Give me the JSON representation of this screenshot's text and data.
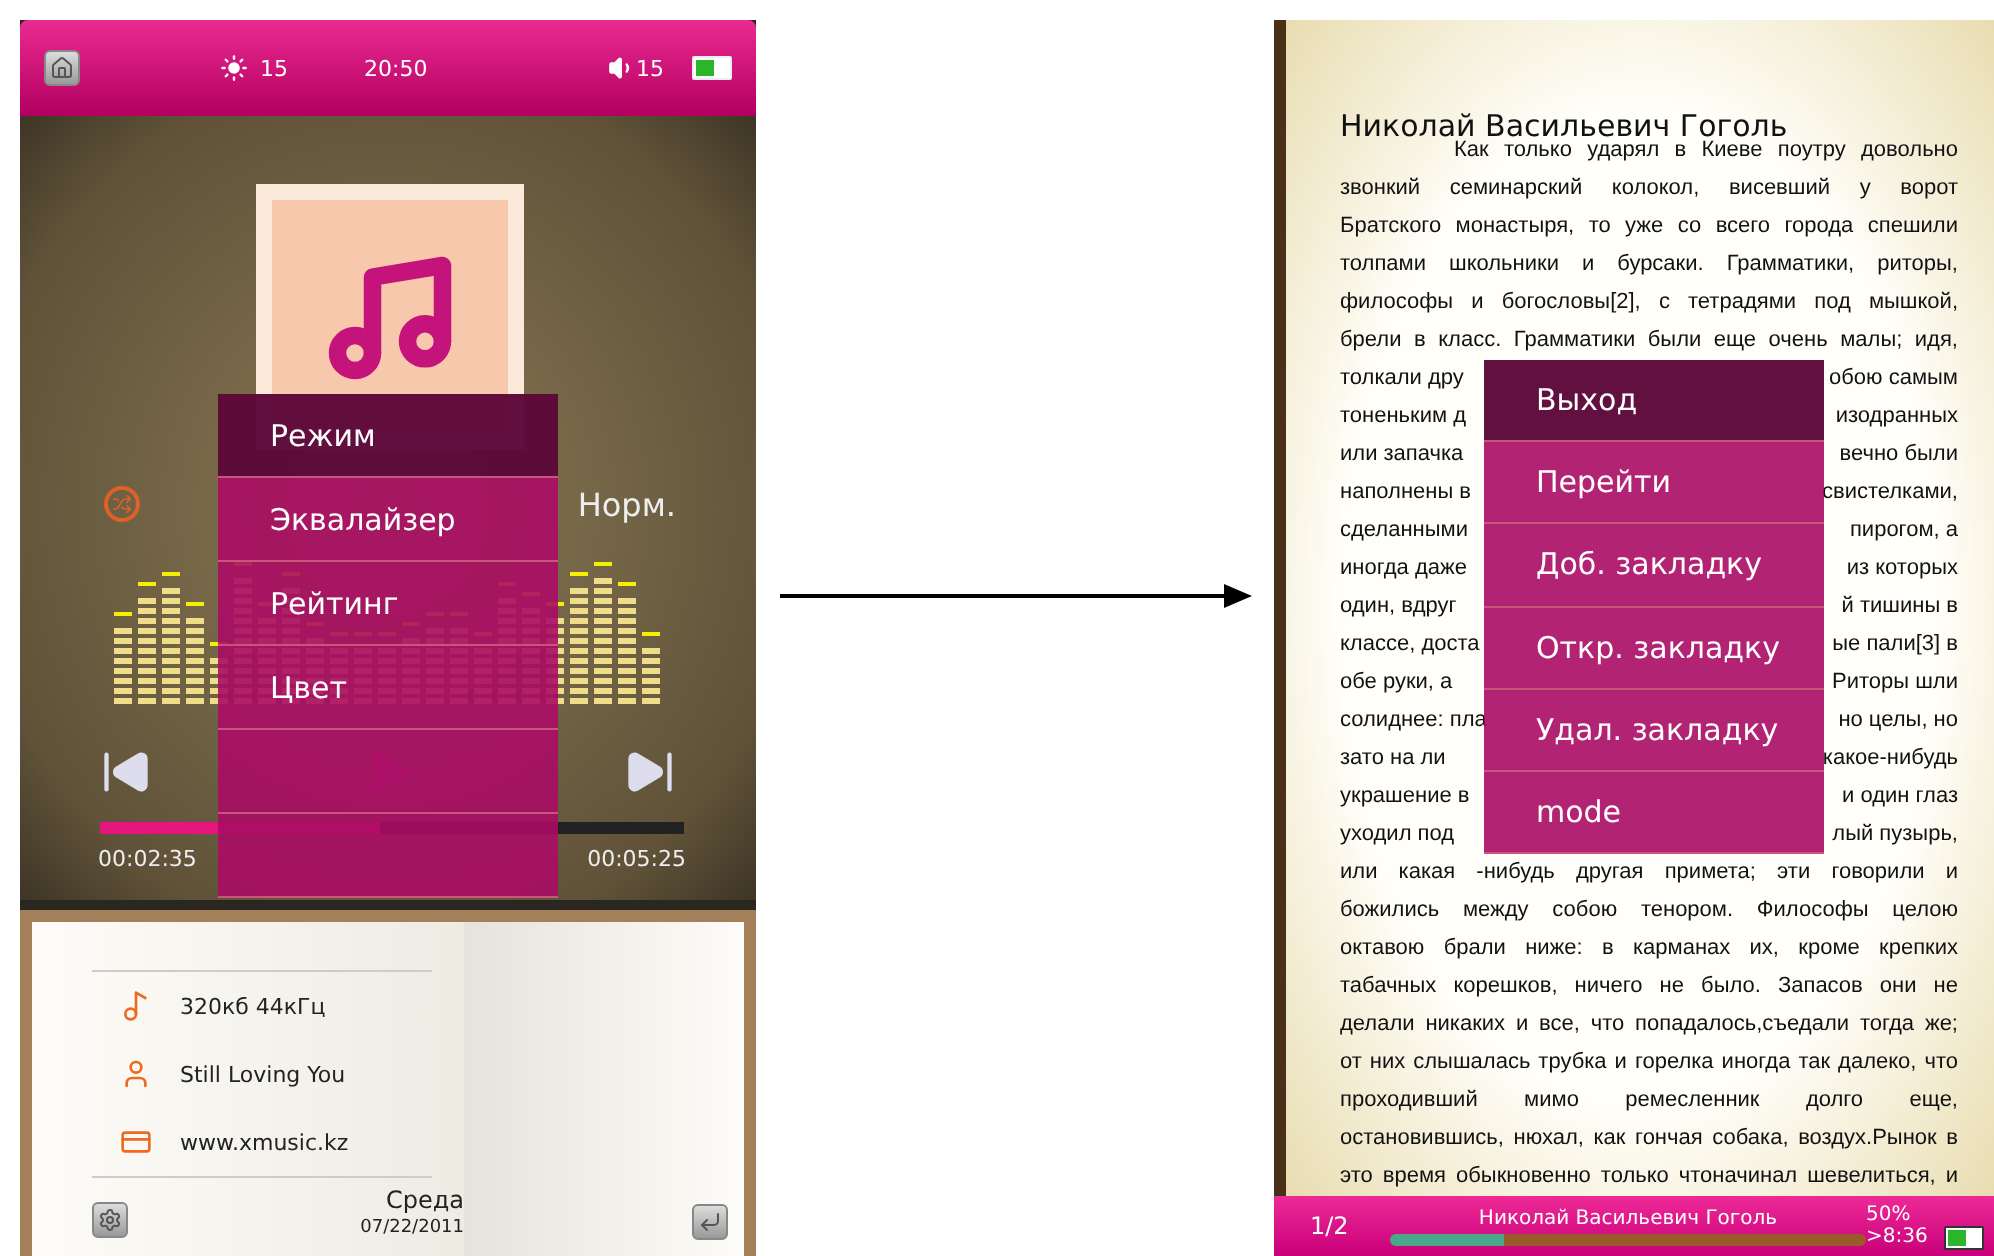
{
  "player": {
    "status_bar": {
      "brightness": "15",
      "time": "20:50",
      "volume": "15"
    },
    "track_info": {
      "eq_preset": "Норм."
    },
    "progress": {
      "level": 0.48,
      "elapsed": "00:02:35",
      "total": "00:05:25"
    },
    "menu": [
      {
        "label": "Режим",
        "selected": true
      },
      {
        "label": "Эквалайзер",
        "selected": false
      },
      {
        "label": "Рейтинг",
        "selected": false
      },
      {
        "label": "Цвет",
        "selected": false
      }
    ],
    "details": [
      {
        "kind": "note",
        "text": "320кб 44кГц"
      },
      {
        "kind": "artist",
        "text": "Still Loving You"
      },
      {
        "kind": "site",
        "text": "www.xmusic.kz"
      }
    ],
    "day": "Среда",
    "date": "07/22/2011"
  },
  "reader": {
    "title": "Николай Васильевич Гоголь",
    "lines": [
      {
        "text": "Как только ударял в Киеве поутру довольно"
      },
      {
        "text": "звонкий семинарский колокол, висевший у ворот"
      },
      {
        "text": "Братского монастыря, то уже со всего города спешили"
      },
      {
        "text": "толпами школьники и бурсаки. Грамматики, риторы,"
      },
      {
        "text": "философы и богословы[2], с тетрадями под мышкой,"
      },
      {
        "text": "брели в класс. Грамматики были еще очень малы; идя,"
      },
      {
        "left": "толкали дру",
        "right": "обою самым"
      },
      {
        "left": "тоненьким д",
        "right": "изодранных"
      },
      {
        "left": "или запачка",
        "right": "вечно были"
      },
      {
        "left": "наполнены в",
        "right": "свистелками,"
      },
      {
        "left": "сделанными",
        "right": "пирогом, а"
      },
      {
        "left": "иногда даже",
        "right": "из которых"
      },
      {
        "left": "один, вдруг",
        "right": "й тишины в"
      },
      {
        "left": "классе, доста",
        "right": "ые пали[3] в"
      },
      {
        "left": "обе руки, а",
        "right": "Риторы шли"
      },
      {
        "left": "солиднее: пла",
        "right": "но целы, но"
      },
      {
        "left": "зато на ли",
        "right": "какое-нибудь"
      },
      {
        "left": "украшение в",
        "right": "и один глаз"
      },
      {
        "left": "уходил под",
        "right": "лый пузырь,"
      },
      {
        "text": "или какая -нибудь другая примета; эти говорили и"
      },
      {
        "text": "божились между собою тенором. Философы целою"
      },
      {
        "text": "октавою брали ниже: в карманах их, кроме крепких"
      },
      {
        "text": "табачных корешков, ничего не было. Запасов они не"
      },
      {
        "text": "делали никаких и все, что попадалось,съедали тогда же;"
      },
      {
        "text": "от них слышалась трубка и горелка иногда так далеко, что"
      },
      {
        "text": "проходивший мимо ремесленник долго еще,"
      },
      {
        "text": "остановившись, нюхал, как гончая собака, воздух.Рынок в"
      },
      {
        "text": "это время обыкновенно только чтоначинал шевелиться, и"
      }
    ],
    "menu": [
      {
        "label": "Выход",
        "selected": true
      },
      {
        "label": "Перейти",
        "selected": false
      },
      {
        "label": "Доб. закладку",
        "selected": false
      },
      {
        "label": "Откр. закладку",
        "selected": false
      },
      {
        "label": "Удал. закладку",
        "selected": false
      },
      {
        "label": "mode",
        "selected": false
      }
    ],
    "footer": {
      "page": "1/2",
      "level": 0.24,
      "title": "Николай Васильевич Гоголь",
      "percent": "50%",
      "time": ">8:36"
    }
  }
}
